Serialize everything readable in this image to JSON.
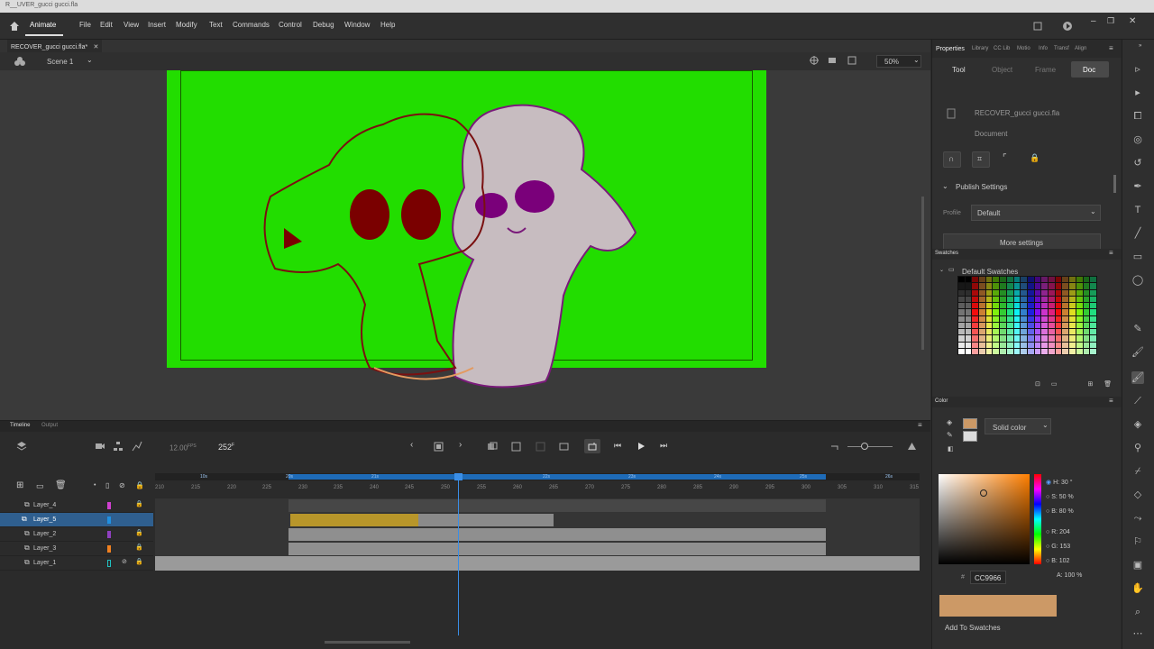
{
  "titlebar": {
    "text": "R__UVER_gucci gucci.fla"
  },
  "menubar": {
    "home_icon": "home-icon",
    "app_name": "Animate",
    "items": [
      "File",
      "Edit",
      "View",
      "Insert",
      "Modify",
      "Text",
      "Commands",
      "Control",
      "Debug",
      "Window",
      "Help"
    ],
    "window_controls": [
      "minimize-icon",
      "maximize-icon",
      "close-icon"
    ]
  },
  "document": {
    "tab_label": "RECOVER_gucci gucci.fla*",
    "scene": "Scene 1",
    "zoom": "50%"
  },
  "timeline": {
    "tabs": [
      "Timeline",
      "Output"
    ],
    "fps": "12.00",
    "fps_unit": "FPS",
    "current_frame": "252",
    "frame_unit": "F",
    "ruler": [
      "210",
      "215",
      "220",
      "225",
      "230",
      "235",
      "240",
      "245",
      "250",
      "255",
      "260",
      "265",
      "270",
      "275",
      "280",
      "285",
      "290",
      "295",
      "300",
      "305",
      "310",
      "315"
    ],
    "ruler_marks": [
      "10s",
      "20s",
      "21s",
      "22s",
      "23s",
      "24s",
      "25s",
      "26s"
    ],
    "layers": [
      {
        "name": "Layer_4",
        "color": "#d040d0",
        "locked": true,
        "selected": false
      },
      {
        "name": "Layer_5",
        "color": "#2090e0",
        "locked": false,
        "selected": true
      },
      {
        "name": "Layer_2",
        "color": "#9040c0",
        "locked": true,
        "selected": false
      },
      {
        "name": "Layer_3",
        "color": "#f08020",
        "locked": true,
        "selected": false
      },
      {
        "name": "Layer_1",
        "color": "#20c0c0",
        "locked": true,
        "selected": false,
        "hidden": true
      }
    ]
  },
  "properties": {
    "panel_tabs": [
      "Properties",
      "Library",
      "CC Lib",
      "Motio",
      "Info",
      "Transf",
      "Align"
    ],
    "sub_tabs": [
      "Tool",
      "Object",
      "Frame",
      "Doc"
    ],
    "active_sub_tab": "Doc",
    "file_name": "RECOVER_gucci gucci.fla",
    "file_type": "Document",
    "publish_settings": "Publish Settings",
    "profile_label": "Profile",
    "profile_value": "Default",
    "more_settings": "More settings"
  },
  "swatches": {
    "title": "Swatches",
    "group": "Default Swatches"
  },
  "color": {
    "title": "Color",
    "fill_type": "Solid color",
    "h": "H: 30 °",
    "s": "S: 50 %",
    "b": "B: 80 %",
    "r": "R: 204",
    "g": "G: 153",
    "bv": "B: 102",
    "a": "A: 100 %",
    "hex_label": "#",
    "hex": "CC9966",
    "swatch_color": "#cc9966",
    "add_to_swatches": "Add To Swatches"
  },
  "colors": {
    "stage": "#22dd00",
    "accent": "#1e6bb8",
    "selected_layer": "#2f5f8f"
  }
}
